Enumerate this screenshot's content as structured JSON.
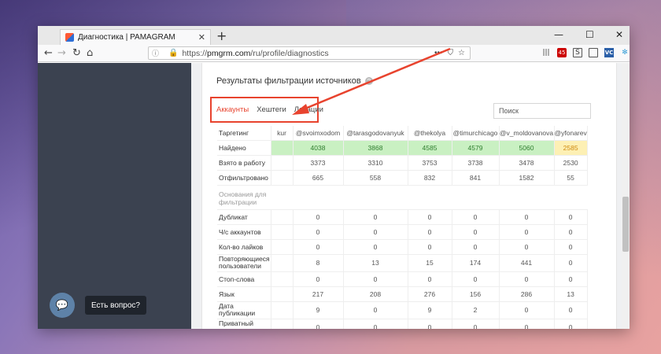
{
  "browser": {
    "tab_title": "Диагностика | PAMAGRAM",
    "tab_close": "✕",
    "new_tab": "+",
    "min": "—",
    "max": "☐",
    "close": "✕",
    "url_scheme": "https://",
    "url_host": "pmgrm.com",
    "url_path": "/ru/profile/diagnostics",
    "abp_count": "45"
  },
  "panel": {
    "title": "Результаты фильтрации источников",
    "tabs": [
      "Аккаунты",
      "Хештеги",
      "Локации"
    ],
    "search_placeholder": "Поиск"
  },
  "table": {
    "header_label": "Таргетинг",
    "columns": [
      "kur",
      "@svoimxodom",
      "@tarasgodovanyuk",
      "@thekolya",
      "@timurchicago",
      "@v_moldovanova",
      "@yfonarev"
    ],
    "top_rows": [
      {
        "label": "Найдено",
        "values": [
          "",
          "4038",
          "3868",
          "4585",
          "4579",
          "5060",
          "2585"
        ]
      },
      {
        "label": "Взято в работу",
        "values": [
          "",
          "3373",
          "3310",
          "3753",
          "3738",
          "3478",
          "2530"
        ]
      },
      {
        "label": "Отфильтровано",
        "values": [
          "",
          "665",
          "558",
          "832",
          "841",
          "1582",
          "55"
        ]
      }
    ],
    "section_label": "Основания для фильтрации",
    "reason_rows": [
      {
        "label": "Дубликат",
        "values": [
          "0",
          "0",
          "0",
          "0",
          "0",
          "0"
        ]
      },
      {
        "label": "Ч/с аккаунтов",
        "values": [
          "0",
          "0",
          "0",
          "0",
          "0",
          "0"
        ]
      },
      {
        "label": "Кол-во лайков",
        "values": [
          "0",
          "0",
          "0",
          "0",
          "0",
          "0"
        ]
      },
      {
        "label": "Повторяющиеся пользователи",
        "values": [
          "8",
          "13",
          "15",
          "174",
          "441",
          "0"
        ]
      },
      {
        "label": "Стоп-слова",
        "values": [
          "0",
          "0",
          "0",
          "0",
          "0",
          "0"
        ]
      },
      {
        "label": "Язык",
        "values": [
          "217",
          "208",
          "276",
          "156",
          "286",
          "13"
        ]
      },
      {
        "label": "Дата публикации",
        "values": [
          "9",
          "0",
          "9",
          "2",
          "0",
          "0"
        ]
      },
      {
        "label": "Приватный аккаунт",
        "values": [
          "0",
          "0",
          "0",
          "0",
          "0",
          "0"
        ]
      }
    ]
  },
  "chat": {
    "label": "Есть вопрос?"
  },
  "colors": {
    "accent": "#e8432e",
    "found_bg": "#c9f0c2",
    "warn_bg": "#fdf0b4",
    "sidebar": "#3b4250"
  }
}
